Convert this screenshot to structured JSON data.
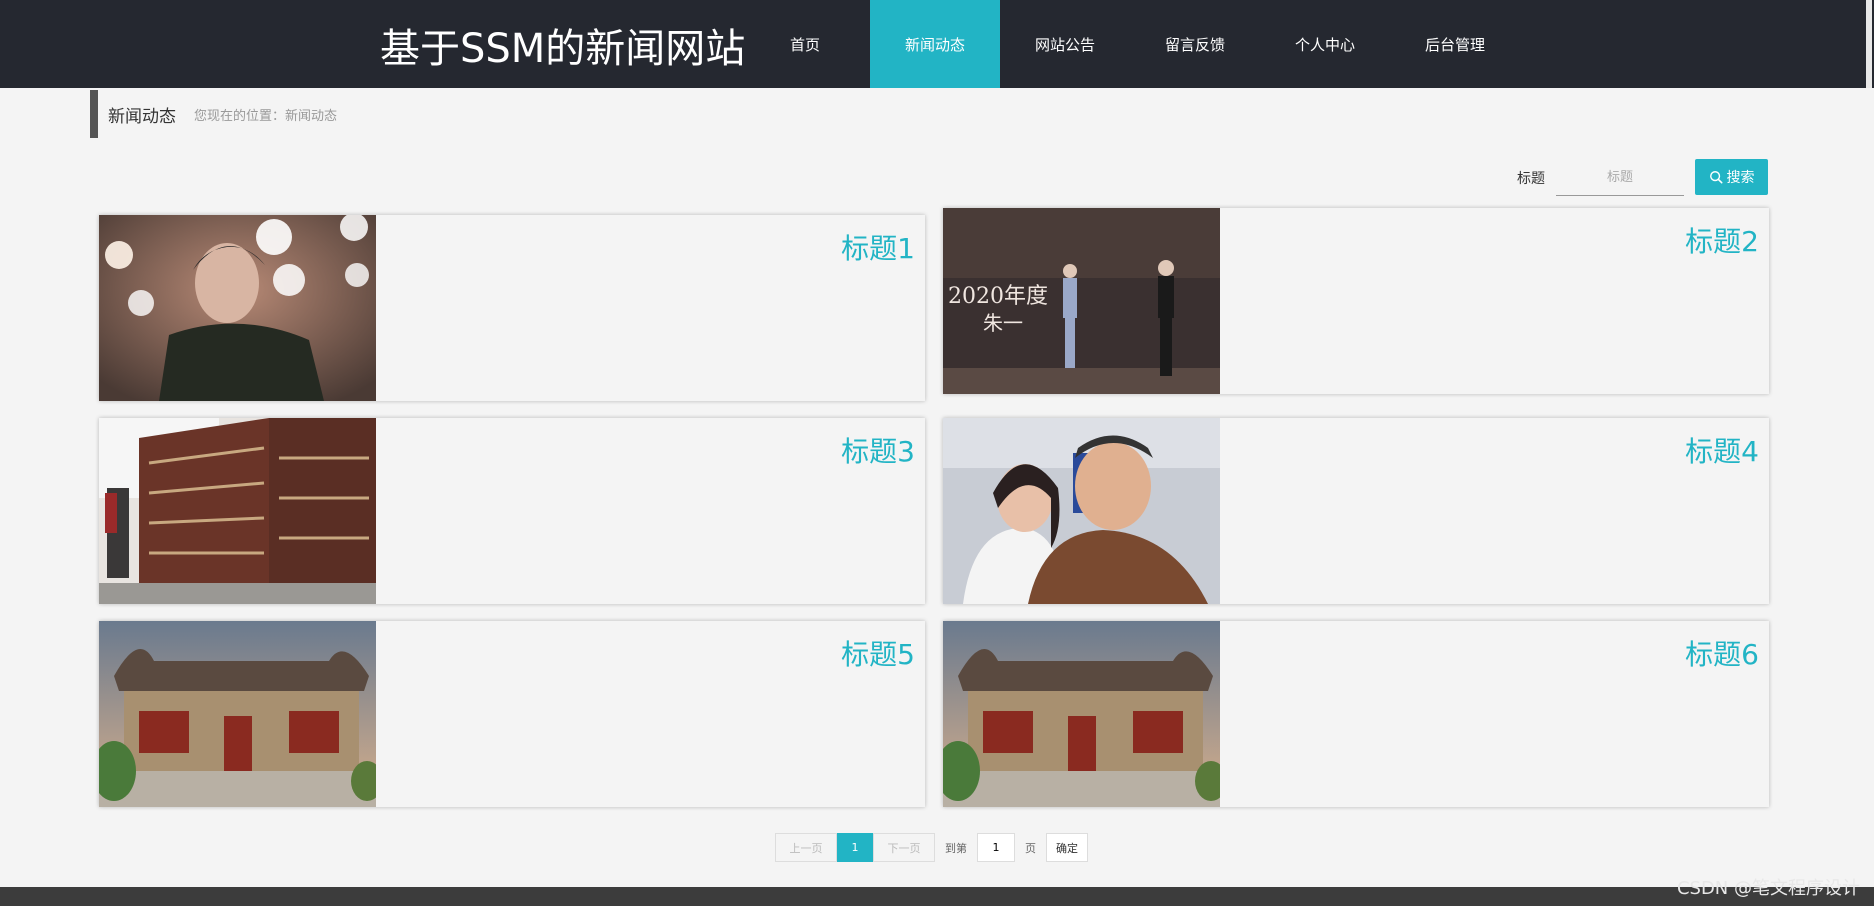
{
  "header": {
    "site_title": "基于SSM的新闻网站",
    "nav": [
      {
        "label": "首页",
        "active": false
      },
      {
        "label": "新闻动态",
        "active": true
      },
      {
        "label": "网站公告",
        "active": false
      },
      {
        "label": "留言反馈",
        "active": false
      },
      {
        "label": "个人中心",
        "active": false
      },
      {
        "label": "后台管理",
        "active": false
      }
    ]
  },
  "breadcrumb": {
    "title": "新闻动态",
    "location": "您现在的位置：新闻动态"
  },
  "search": {
    "label": "标题",
    "placeholder": "标题",
    "button": "搜索"
  },
  "news": [
    {
      "title": "标题1",
      "image": "portrait-man-bokeh"
    },
    {
      "title": "标题2",
      "image": "award-stage"
    },
    {
      "title": "标题3",
      "image": "library-shelves"
    },
    {
      "title": "标题4",
      "image": "couple-smiling"
    },
    {
      "title": "标题5",
      "image": "traditional-building"
    },
    {
      "title": "标题6",
      "image": "traditional-building"
    }
  ],
  "pagination": {
    "prev": "上一页",
    "current": "1",
    "next": "下一页",
    "goto_label": "到第",
    "page_value": "1",
    "page_suffix": "页",
    "confirm": "确定"
  },
  "watermark": "CSDN @笔文程序设计",
  "colors": {
    "accent": "#22b4c5",
    "header_bg": "#252830"
  }
}
